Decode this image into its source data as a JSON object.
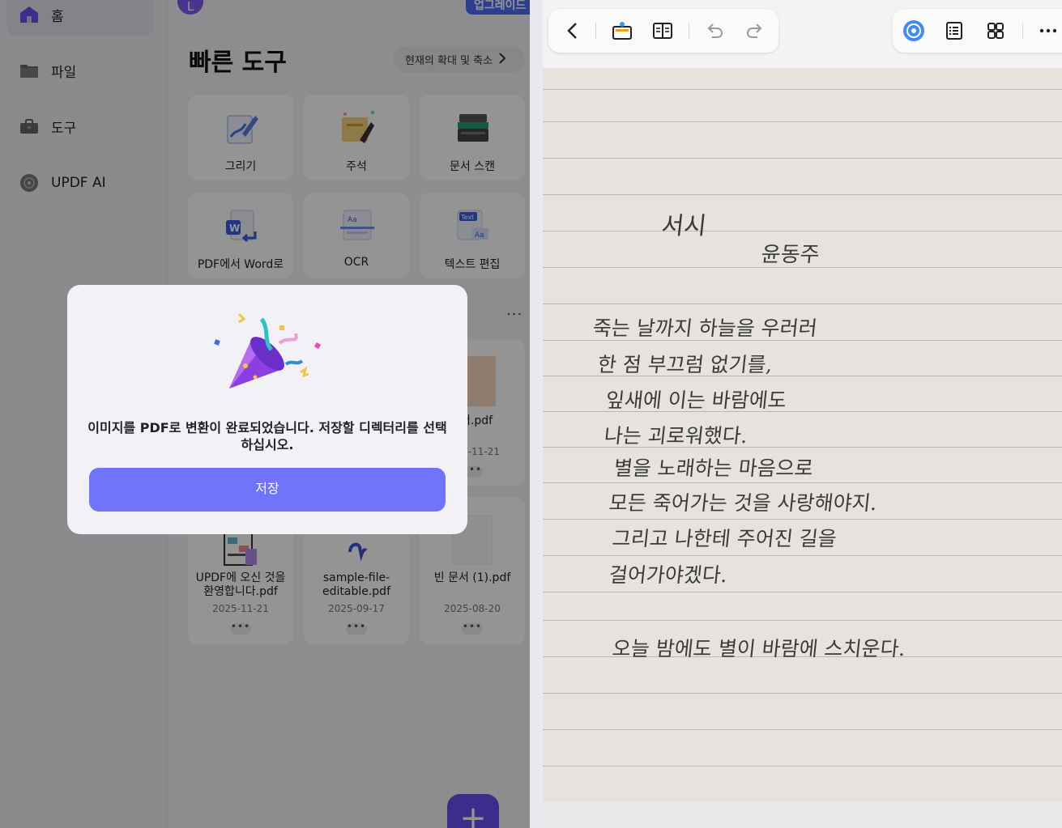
{
  "left_app": {
    "sidebar": {
      "items": [
        {
          "label": "홈",
          "icon": "home-icon",
          "active": true
        },
        {
          "label": "파일",
          "icon": "folder-icon",
          "active": false
        },
        {
          "label": "도구",
          "icon": "toolbox-icon",
          "active": false
        },
        {
          "label": "UPDF AI",
          "icon": "ai-icon",
          "active": false
        }
      ]
    },
    "header": {
      "avatar_initial": "L",
      "upgrade_label": "업그레이드"
    },
    "quick_tools": {
      "title": "빠른 도구",
      "zoom_link": "현재의 확대 및 축소",
      "tools": [
        {
          "label": "그리기",
          "icon": "draw-icon"
        },
        {
          "label": "주석",
          "icon": "annotate-icon"
        },
        {
          "label": "문서 스캔",
          "icon": "scan-icon"
        },
        {
          "label": "PDF에서 Word로",
          "icon": "pdf-to-word-icon"
        },
        {
          "label": "OCR",
          "icon": "ocr-icon"
        },
        {
          "label": "텍스트 편집",
          "icon": "text-edit-icon"
        }
      ]
    },
    "recent_files": {
      "more_label": "···",
      "files": [
        {
          "name": "서.pdf",
          "date": "5-11-21"
        },
        {
          "name": "UPDF에 오신 것을 환영합니다.pdf",
          "date": "2025-11-21"
        },
        {
          "name": "sample-file-editable.pdf",
          "date": "2025-09-17"
        },
        {
          "name": "빈 문서 (1).pdf",
          "date": "2025-08-20"
        }
      ],
      "file_more_label": "•••"
    },
    "fab_label": "+",
    "dialog": {
      "message": "이미지를 PDF로 변환이 완료되었습니다. 저장할 디렉터리를 선택하십시오.",
      "save_label": "저장"
    },
    "colors": {
      "accent": "#6a4cf0",
      "save_button": "#7074fb",
      "overlay": "rgba(0,0,0,0.42)"
    }
  },
  "right_app": {
    "toolbar_left": [
      "back-icon",
      "tag-icon",
      "book-view-icon",
      "undo-icon",
      "redo-icon"
    ],
    "toolbar_right": [
      "ai-assistant-icon",
      "outline-icon",
      "grid-view-icon",
      "more-icon"
    ],
    "handwriting": {
      "title": "서시",
      "author": "윤동주",
      "lines": [
        "죽는 날까지 하늘을 우러러",
        "한 점 부끄럼 없기를,",
        "잎새에 이는 바람에도",
        "나는 괴로워했다.",
        "별을 노래하는 마음으로",
        "모든 죽어가는 것을 사랑해야지.",
        "그리고 나한테 주어진 길을",
        "걸어가야겠다.",
        "오늘 밤에도 별이 바람에 스치운다."
      ]
    }
  }
}
